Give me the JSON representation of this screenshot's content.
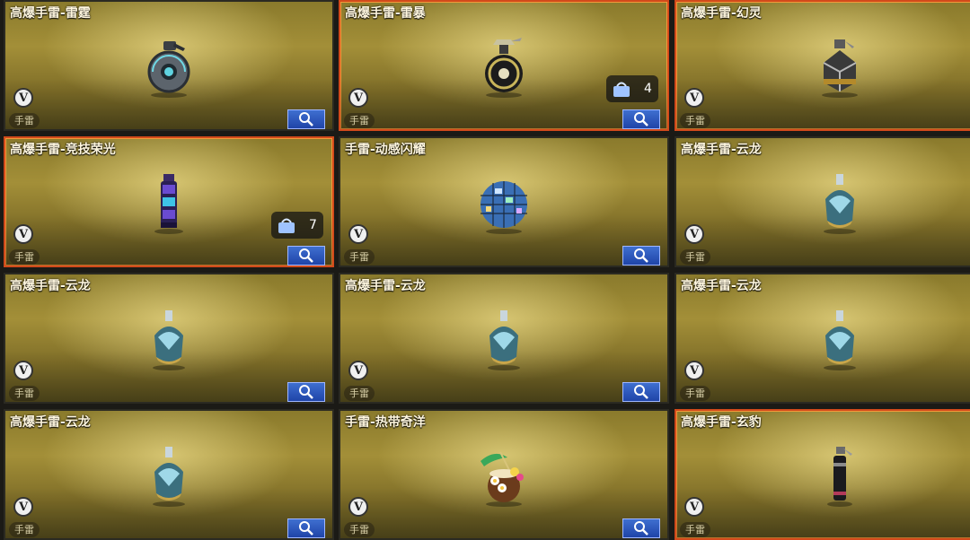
{
  "category_label": "手雷",
  "cards": [
    {
      "title": "高爆手雷-雷霆",
      "item_icon": "grenade-thunder-icon",
      "selected": false,
      "count": null
    },
    {
      "title": "高爆手雷-雷暴",
      "item_icon": "grenade-storm-icon",
      "selected": true,
      "count": "4"
    },
    {
      "title": "高爆手雷-幻灵",
      "item_icon": "grenade-phantom-icon",
      "selected": true,
      "count": ""
    },
    {
      "title": "高爆手雷-竞技荣光",
      "item_icon": "grenade-glory-icon",
      "selected": true,
      "count": "7"
    },
    {
      "title": "手雷-动感闪耀",
      "item_icon": "disco-ball-grenade-icon",
      "selected": false,
      "count": null
    },
    {
      "title": "高爆手雷-云龙",
      "item_icon": "grenade-cloud-dragon-icon",
      "selected": false,
      "count": null
    },
    {
      "title": "高爆手雷-云龙",
      "item_icon": "grenade-cloud-dragon-icon",
      "selected": false,
      "count": null
    },
    {
      "title": "高爆手雷-云龙",
      "item_icon": "grenade-cloud-dragon-icon",
      "selected": false,
      "count": null
    },
    {
      "title": "高爆手雷-云龙",
      "item_icon": "grenade-cloud-dragon-icon",
      "selected": false,
      "count": null
    },
    {
      "title": "高爆手雷-云龙",
      "item_icon": "grenade-cloud-dragon-icon",
      "selected": false,
      "count": null
    },
    {
      "title": "手雷-热带奇洋",
      "item_icon": "coconut-drink-grenade-icon",
      "selected": false,
      "count": null
    },
    {
      "title": "高爆手雷-玄豹",
      "item_icon": "grenade-black-panther-icon",
      "selected": true,
      "count": ""
    }
  ]
}
